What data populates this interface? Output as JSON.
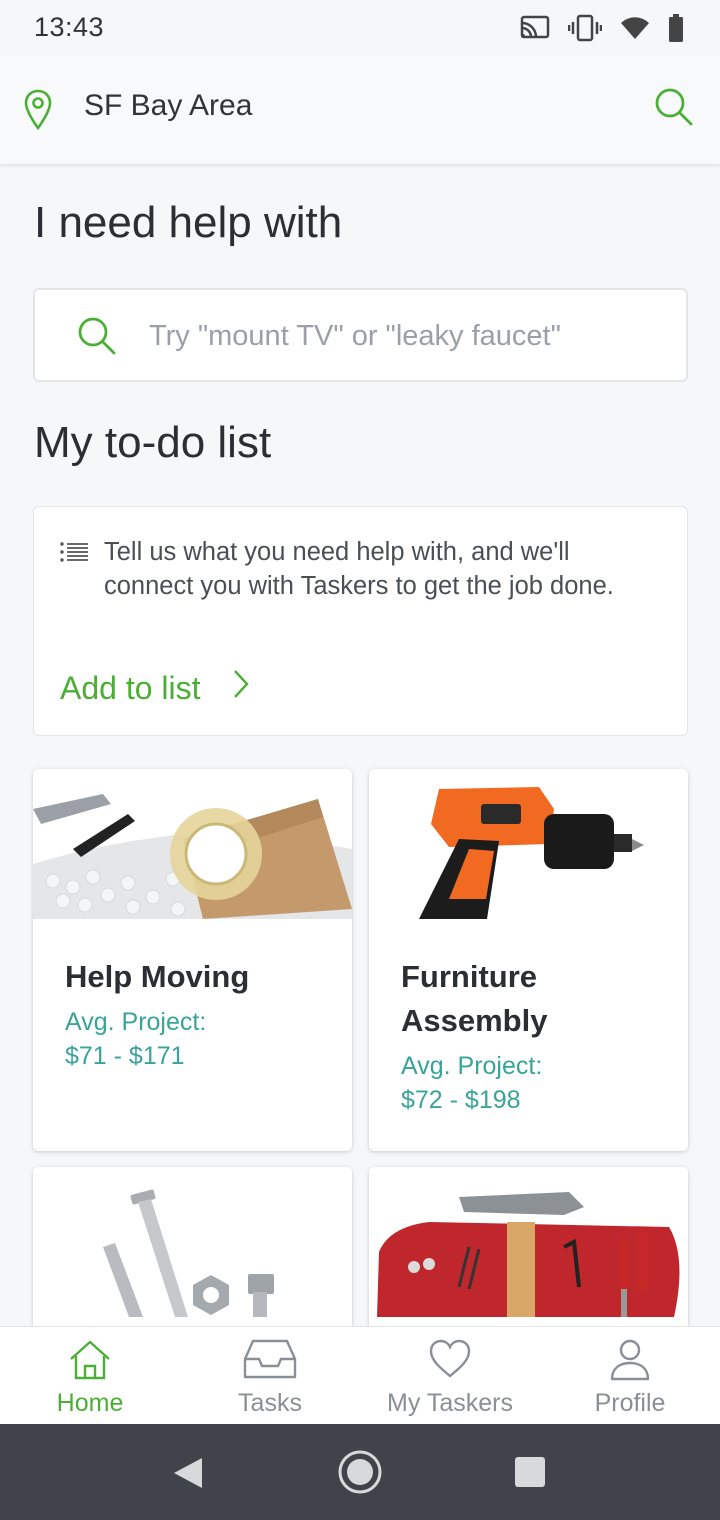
{
  "status": {
    "time": "13:43",
    "icons": [
      "cast-icon",
      "vibrate-icon",
      "wifi-icon",
      "battery-icon"
    ]
  },
  "topbar": {
    "location": "SF Bay Area",
    "location_icon": "map-pin-icon",
    "search_icon": "search-icon"
  },
  "help": {
    "heading": "I need help with",
    "search_placeholder": "Try \"mount TV\" or \"leaky faucet\""
  },
  "todo": {
    "heading": "My to-do list",
    "description": "Tell us what you need help with, and we'll connect you with Taskers to get the job done.",
    "add_label": "Add to list"
  },
  "categories": [
    {
      "title": "Help Moving",
      "avg_label": "Avg. Project:",
      "price": "$71 - $171",
      "image": "packing-supplies"
    },
    {
      "title": "Furniture Assembly",
      "avg_label": "Avg. Project:",
      "price": "$72 - $198",
      "image": "power-drill"
    },
    {
      "title": "",
      "avg_label": "",
      "price": "",
      "image": "bolts-and-nuts"
    },
    {
      "title": "",
      "avg_label": "",
      "price": "",
      "image": "hammer-and-tools"
    }
  ],
  "bottom_nav": [
    {
      "label": "Home",
      "icon": "home-icon",
      "active": true
    },
    {
      "label": "Tasks",
      "icon": "inbox-icon",
      "active": false
    },
    {
      "label": "My Taskers",
      "icon": "heart-icon",
      "active": false
    },
    {
      "label": "Profile",
      "icon": "person-icon",
      "active": false
    }
  ],
  "colors": {
    "accent_green": "#4caf35",
    "price_teal": "#3aa39a",
    "background": "#f6f7f8",
    "system_nav": "#40444a"
  }
}
